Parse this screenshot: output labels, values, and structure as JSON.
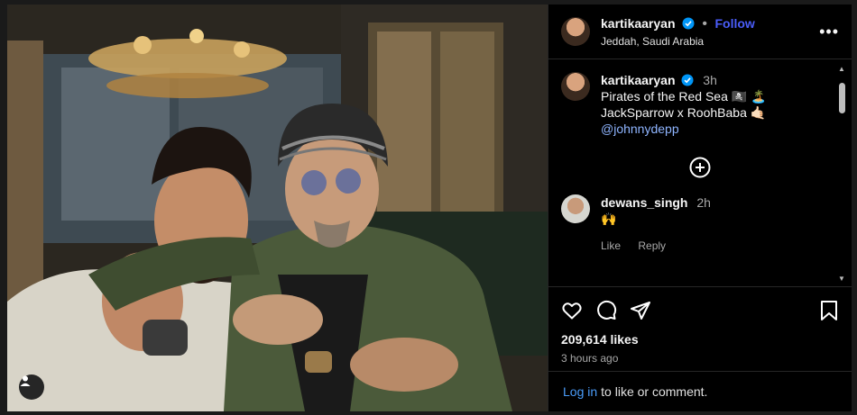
{
  "post": {
    "username": "kartikaaryan",
    "follow_label": "Follow",
    "location": "Jeddah, Saudi Arabia",
    "more_icon": "more-horizontal-icon"
  },
  "caption": {
    "username": "kartikaaryan",
    "time": "3h",
    "line1": "Pirates of the Red Sea 🏴‍☠️ 🏝️",
    "line2": "JackSparrow x RoohBaba 🤙🏻",
    "mention": "@johnnydepp"
  },
  "comments": [
    {
      "username": "dewans_singh",
      "time": "2h",
      "text": "🙌",
      "like_label": "Like",
      "reply_label": "Reply"
    }
  ],
  "actions": {
    "likes": "209,614 likes",
    "posted": "3 hours ago"
  },
  "login": {
    "link": "Log in",
    "rest": "to like or comment."
  },
  "colors": {
    "accent": "#4a5df9",
    "link": "#4a9cf9",
    "background": "#000000"
  }
}
